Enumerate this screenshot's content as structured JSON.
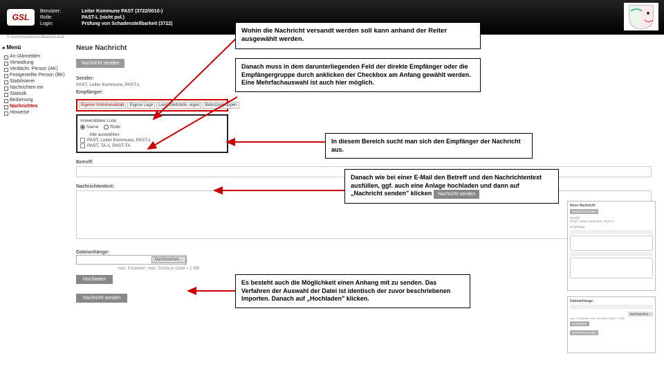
{
  "header": {
    "logo": "GSL",
    "labels": {
      "user": "Benutzer:",
      "role": "Rolle:",
      "login": "Login:"
    },
    "user": "Leiter Kommune PAST (3722/0010-)",
    "role": "PAST-L (nicht pol.)",
    "login": "Prüfung von Schadenstellbarkeit (3722)",
    "sub": "© Kommune/Kreis/Bezirk/Land"
  },
  "menu": {
    "title": "Menü",
    "items": [
      "An-/Abmelden",
      "Verwaltung",
      "Verdächt. Person (AK)",
      "Festgestellte Person (BK)",
      "Stabilisierer",
      "Nachrichten ein",
      "Statistik",
      "Bedienung",
      "Nachrichten",
      "Hinweise"
    ]
  },
  "page": {
    "title": "Neue Nachricht",
    "send": "Nachricht senden",
    "senderLabel": "Sender:",
    "sender": "PAST, Leiter Kommune, PAST-L",
    "recipientsLabel": "Empfänger:",
    "tabs": [
      "Eigener Kommunalstab",
      "Eigene Lage",
      "Landesleitstelle, eigen",
      "Benutzergruppen"
    ],
    "filterLabel": "Anwendbare Liste:",
    "radios": {
      "name": "Name",
      "role": "Rolle"
    },
    "rows": [
      "Alle auswählen",
      "PAST, Leiter Kommune, PAST-L",
      "PAST, TA-1, PAST-TA"
    ],
    "subject": "Betreff:",
    "body": "Nachrichtentext:",
    "attach": "Dateianhänge:",
    "browse": "Durchsuchen...",
    "upload": "Hochladen",
    "limit": "max. 5 Dateien, max. Größe je Datei = 2 MB",
    "send2": "Nachricht senden"
  },
  "callouts": {
    "c1": "Wohin die Nachricht versandt werden soll kann anhand der Reiter ausgewählt werden.",
    "c2": "Danach muss in dem darunterliegenden Feld der direkte Empfänger oder die Empfängergruppe durch anklicken der Checkbox am Anfang gewählt werden. Eine Mehrfachauswahl ist auch hier möglich.",
    "c3": "In diesem Bereich sucht man sich den Empfänger der Nachricht aus.",
    "c4a": "Danach wie bei einer E-Mail den Betreff und den Nachrichtentext ausfüllen, ggf. auch eine Anlage hochladen und dann auf „Nachricht senden\" klicken",
    "c4btn": "Nachricht senden",
    "c5": "Es besteht auch die Möglichkeit einen Anhang mit zu senden. Das Verfahren der Auswahl der Datei ist identisch der zuvor beschriebenen Importen. Danach auf „Hochladen\" klicken."
  },
  "overlay": {
    "t1": "Neue Nachricht",
    "s1": "Sender",
    "s2": "PAST, Leiter Kommune, PAST-L",
    "s3": "Empfänger",
    "t2": "Dateianhänge:",
    "limit": "max. 5 Dateien, max. Größe je Datei = 2 MB",
    "b1": "Durchsuchen...",
    "b2": "Hochladen",
    "b3": "Nachricht senden"
  }
}
